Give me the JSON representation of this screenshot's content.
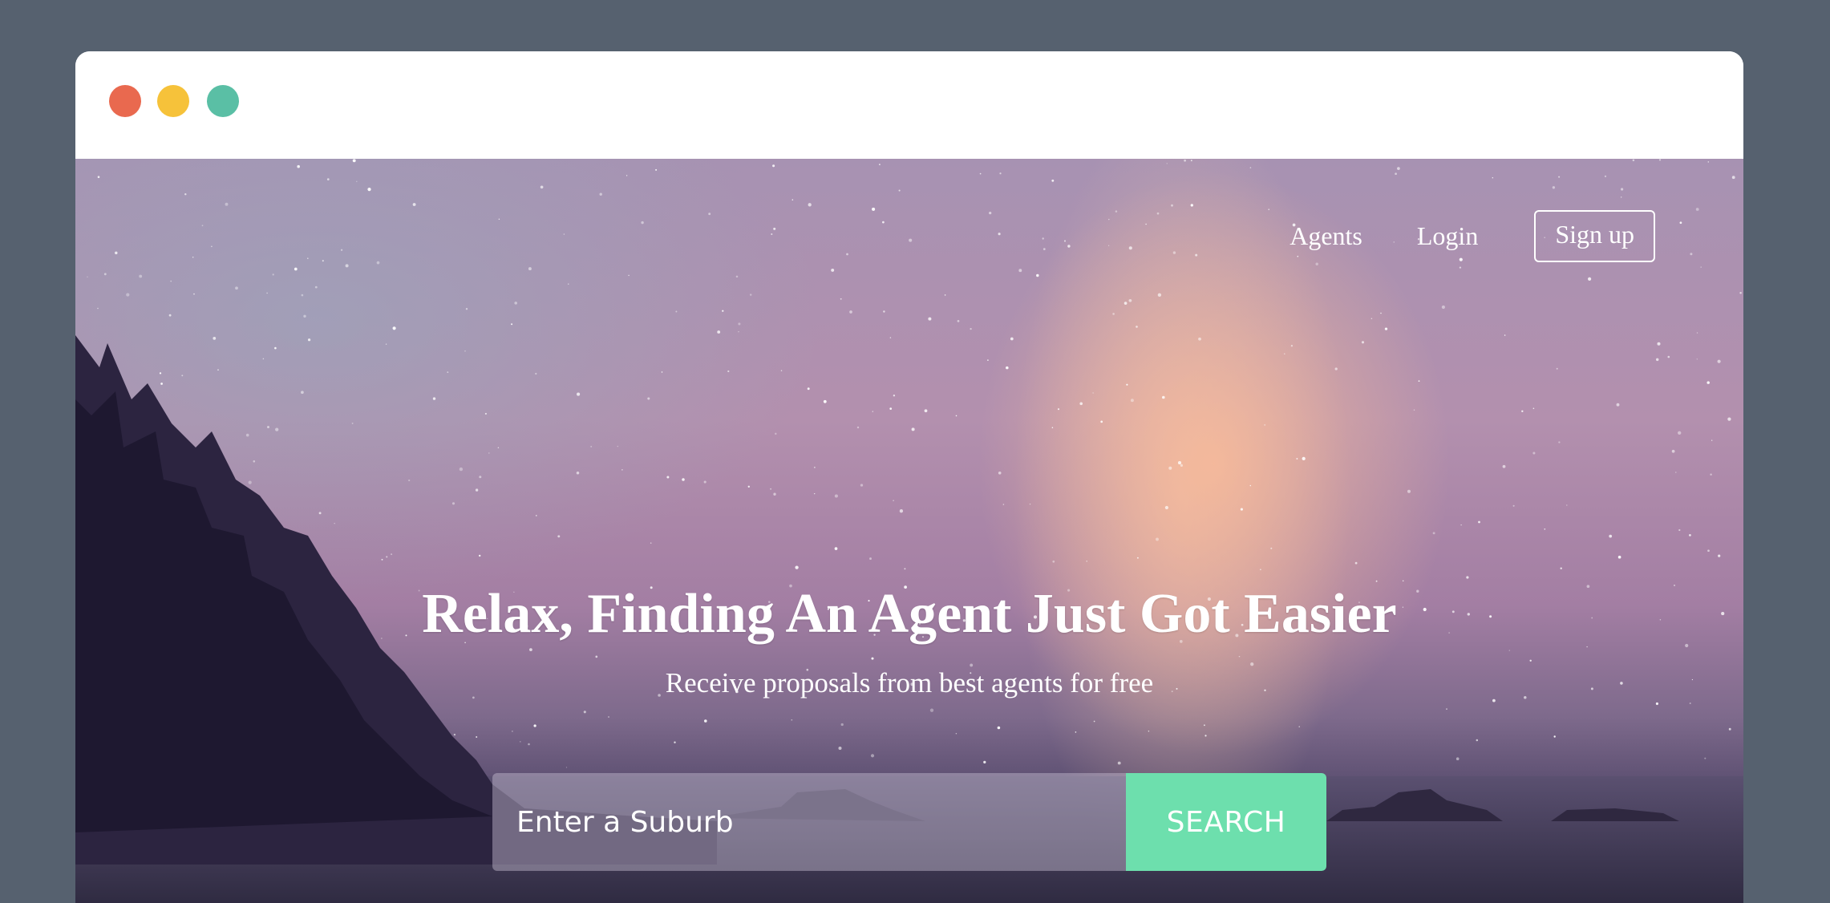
{
  "window": {
    "controls": [
      "close",
      "minimize",
      "maximize"
    ]
  },
  "nav": {
    "agents_label": "Agents",
    "login_label": "Login",
    "signup_label": "Sign up"
  },
  "hero": {
    "headline": "Relax, Finding An Agent Just Got Easier",
    "subheadline": "Receive proposals from best agents for free"
  },
  "search": {
    "placeholder": "Enter a Suburb",
    "value": "",
    "button_label": "SEARCH"
  },
  "colors": {
    "page_background": "#56616f",
    "close_dot": "#e9694f",
    "minimize_dot": "#f6c23a",
    "maximize_dot": "#5abfa5",
    "search_button": "#6ddfad"
  }
}
